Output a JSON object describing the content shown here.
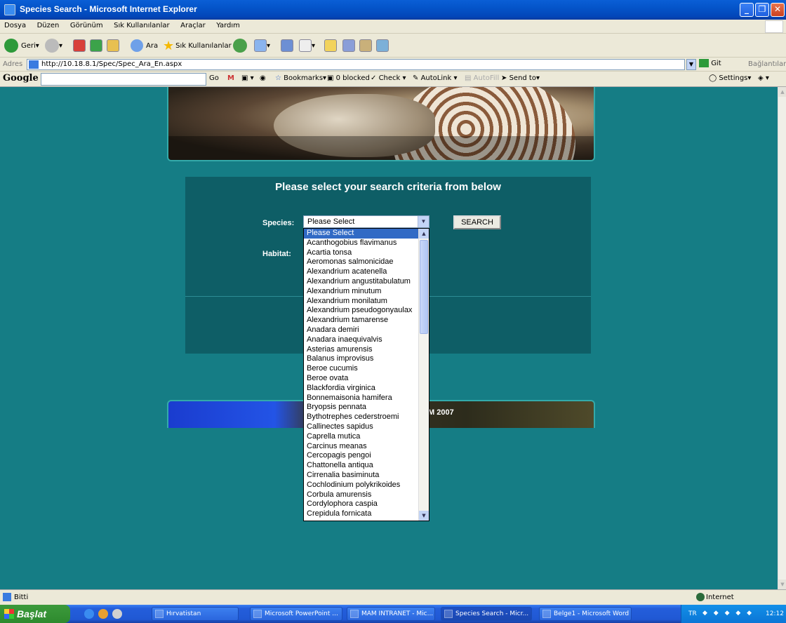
{
  "window": {
    "title": "Species Search - Microsoft Internet Explorer"
  },
  "menu": [
    "Dosya",
    "Düzen",
    "Görünüm",
    "Sık Kullanılanlar",
    "Araçlar",
    "Yardım"
  ],
  "toolbar": {
    "back": "Geri",
    "search": "Ara",
    "favorites": "Sık Kullanılanlar"
  },
  "address": {
    "label": "Adres",
    "url": "http://10.18.8.1/Spec/Spec_Ara_En.aspx",
    "go": "Git",
    "links": "Bağlantılar"
  },
  "googlebar": {
    "logo": "Google",
    "go": "Go",
    "bookmarks": "Bookmarks▾",
    "blocked": "0 blocked",
    "check": "Check ▾",
    "autolink": "AutoLink ▾",
    "autofill": "AutoFill",
    "sendto": "Send to▾",
    "settings": "Settings▾"
  },
  "page": {
    "heading": "Please select your search criteria from below",
    "species_label": "Species:",
    "habitat_label": "Habitat:",
    "species_selected": "Please Select",
    "search_button": "SEARCH",
    "footer_text": "M 2007",
    "species_options": [
      "Please Select",
      "Acanthogobius flavimanus",
      "Acartia tonsa",
      "Aeromonas salmonicidae",
      "Alexandrium acatenella",
      "Alexandrium angustitabulatum",
      "Alexandrium minutum",
      "Alexandrium monilatum",
      "Alexandrium pseudogonyaulax",
      "Alexandrium tamarense",
      "Anadara demiri",
      "Anadara inaequivalvis",
      "Asterias amurensis",
      "Balanus improvisus",
      "Beroe cucumis",
      "Beroe ovata",
      "Blackfordia virginica",
      "Bonnemaisonia hamifera",
      "Bryopsis pennata",
      "Bythotrephes cederstroemi",
      "Callinectes sapidus",
      "Caprella mutica",
      "Carcinus meanas",
      "Cercopagis pengoi",
      "Chattonella antiqua",
      "Cirrenalia basiminuta",
      "Cochlodinium polykrikoides",
      "Corbula amurensis",
      "Cordylophora caspia",
      "Crepidula fornicata"
    ]
  },
  "status": {
    "left": "Bitti",
    "zone": "Internet"
  },
  "taskbar": {
    "start": "Başlat",
    "tasks": [
      "Hırvatistan",
      "Microsoft PowerPoint ...",
      "MAM INTRANET - Mic...",
      "Species Search - Micr...",
      "Belge1 - Microsoft Word"
    ],
    "lang": "TR",
    "clock": "12:12"
  }
}
